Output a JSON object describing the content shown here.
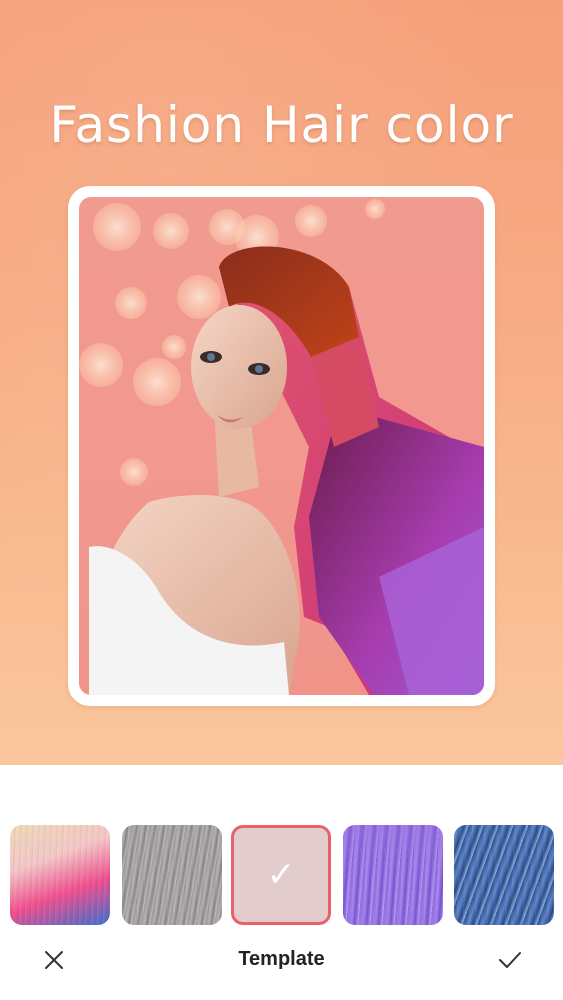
{
  "hero": {
    "title": "Fashion Hair color",
    "background_color": "#f7ab84"
  },
  "template_swatches": [
    {
      "name": "pink-blue-ombre",
      "selected": false
    },
    {
      "name": "silver-gray",
      "selected": false
    },
    {
      "name": "rose-beige",
      "selected": true,
      "icon": "check-icon"
    },
    {
      "name": "lavender-purple",
      "selected": false
    },
    {
      "name": "denim-blue",
      "selected": false
    }
  ],
  "footer": {
    "title": "Template",
    "close_icon": "close-icon",
    "confirm_icon": "check-icon"
  },
  "colors": {
    "accent": "#e9606c",
    "text": "#222222"
  }
}
